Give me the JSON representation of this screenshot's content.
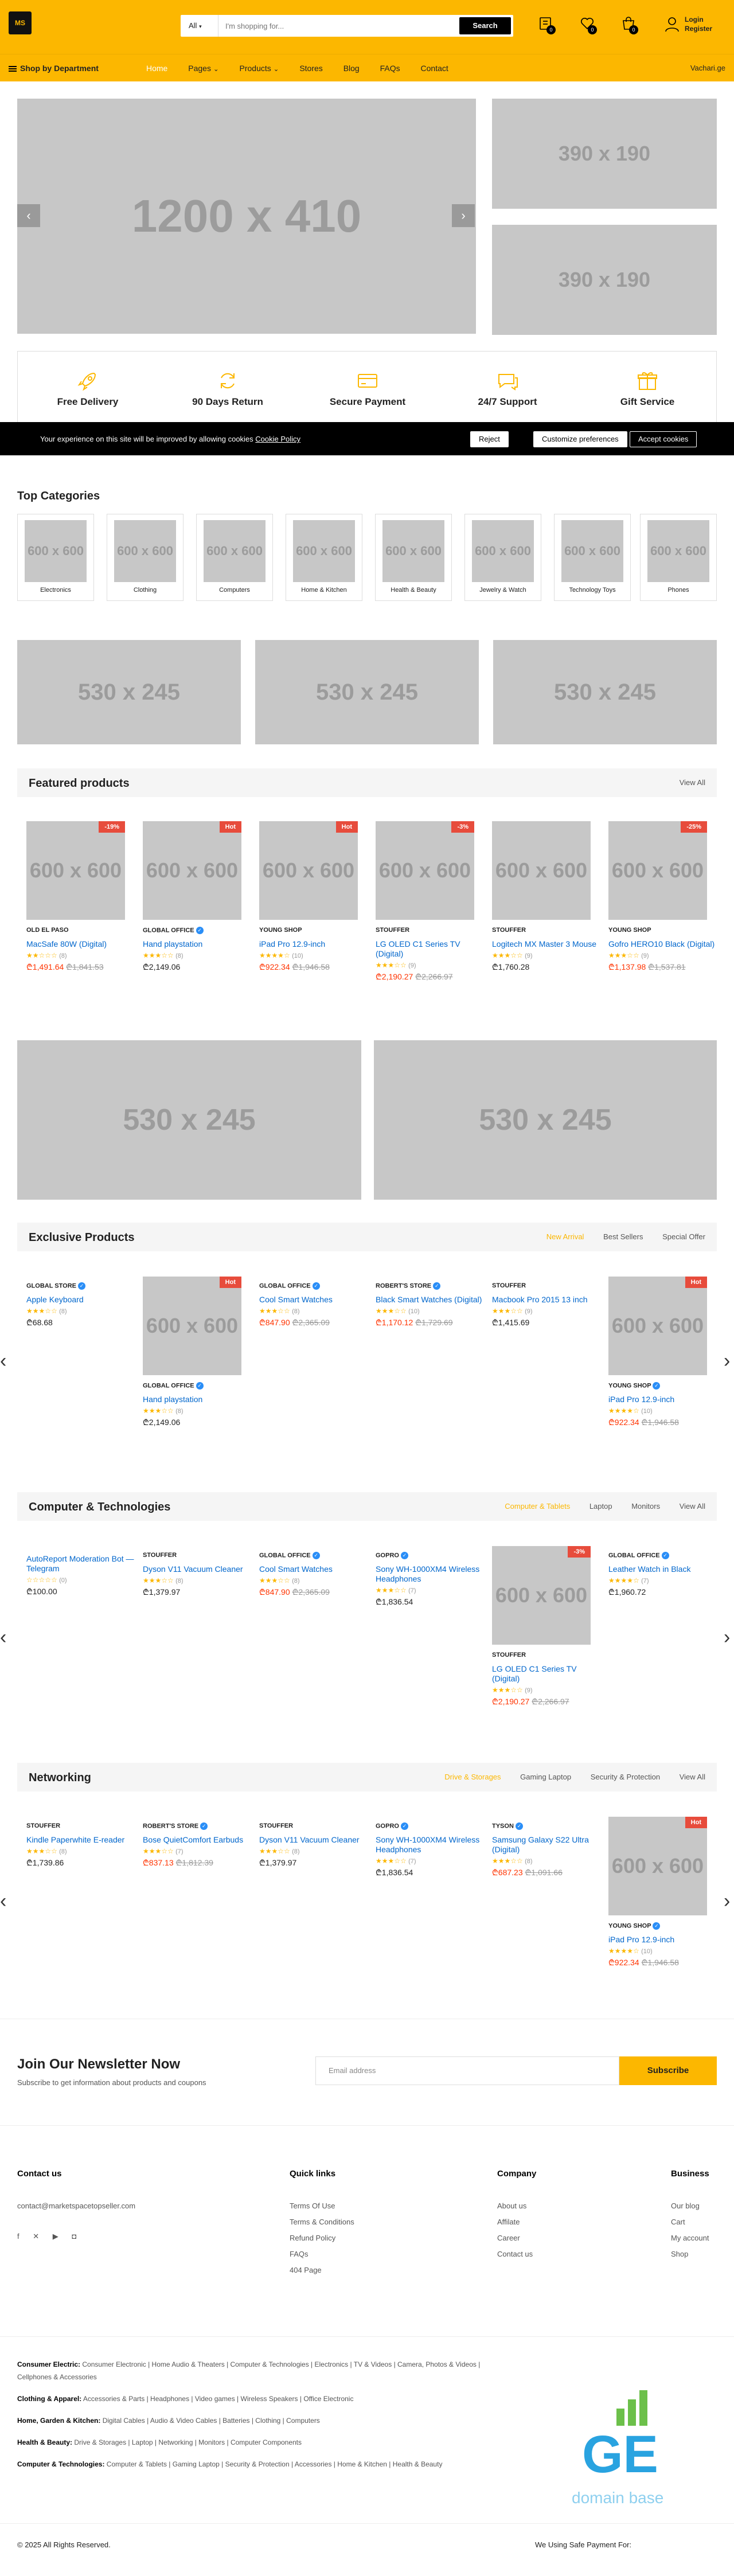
{
  "header": {
    "logo_text": "MS",
    "search_category": "All",
    "search_placeholder": "I'm shopping for...",
    "search_button": "Search",
    "compare_count": "0",
    "wishlist_count": "0",
    "cart_count": "0",
    "login": "Login",
    "register": "Register"
  },
  "nav": {
    "department": "Shop by Department",
    "items": [
      "Home",
      "Pages",
      "Products",
      "Stores",
      "Blog",
      "FAQs",
      "Contact"
    ],
    "right_link": "Vachari.ge"
  },
  "hero": {
    "main": "1200 x 410",
    "side1": "390 x 190",
    "side2": "390 x 190",
    "prev": "‹",
    "next": "›"
  },
  "features": [
    {
      "title": "Free Delivery",
      "icon": "rocket-icon"
    },
    {
      "title": "90 Days Return",
      "icon": "refresh-icon"
    },
    {
      "title": "Secure Payment",
      "icon": "credit-card-icon"
    },
    {
      "title": "24/7 Support",
      "icon": "chat-icon"
    },
    {
      "title": "Gift Service",
      "icon": "gift-icon"
    }
  ],
  "cookie": {
    "message": "Your experience on this site will be improved by allowing cookies",
    "policy": "Cookie Policy",
    "reject": "Reject",
    "customize": "Customize preferences",
    "accept": "Accept cookies"
  },
  "top_categories": {
    "title": "Top Categories",
    "items": [
      "Electronics",
      "Clothing",
      "Computers",
      "Home & Kitchen",
      "Health & Beauty",
      "Jewelry & Watch",
      "Technology Toys",
      "Phones"
    ],
    "ph": "600 x 600"
  },
  "promo_ph": "530 x 245",
  "featured": {
    "title": "Featured products",
    "view_all": "View All",
    "ph": "600 x 600",
    "products": [
      {
        "shop": "OLD EL PASO",
        "name": "MacSafe 80W (Digital)",
        "stars": "★★☆☆☆",
        "reviews": "(8)",
        "price": "₾1,491.64",
        "old": "₾1,841.53",
        "tag": "-19%"
      },
      {
        "shop": "GLOBAL OFFICE",
        "name": "Hand playstation",
        "stars": "★★★☆☆",
        "reviews": "(8)",
        "price": "₾2,149.06",
        "old": "",
        "tag": "Hot"
      },
      {
        "shop": "YOUNG SHOP",
        "name": "iPad Pro 12.9-inch",
        "stars": "★★★★☆",
        "reviews": "(10)",
        "price": "₾922.34",
        "old": "₾1,946.58",
        "tag": "Hot"
      },
      {
        "shop": "STOUFFER",
        "name": "LG OLED C1 Series TV (Digital)",
        "stars": "★★★☆☆",
        "reviews": "(9)",
        "price": "₾2,190.27",
        "old": "₾2,266.97",
        "tag": "-3%"
      },
      {
        "shop": "STOUFFER",
        "name": "Logitech MX Master 3 Mouse",
        "stars": "★★★☆☆",
        "reviews": "(9)",
        "price": "₾1,760.28",
        "old": "",
        "tag": ""
      },
      {
        "shop": "YOUNG SHOP",
        "name": "Gofro HERO10 Black (Digital)",
        "stars": "★★★☆☆",
        "reviews": "(9)",
        "price": "₾1,137.98",
        "old": "₾1,537.81",
        "tag": "-25%"
      }
    ]
  },
  "exclusive": {
    "title": "Exclusive Products",
    "tabs": [
      "New Arrival",
      "Best Sellers",
      "Special Offer"
    ],
    "col1": {
      "shop": "GLOBAL STORE",
      "name": "Apple Keyboard",
      "stars": "★★★☆☆",
      "reviews": "(8)",
      "price": "₾68.68"
    },
    "col2": {
      "shop": "GLOBAL OFFICE",
      "name": "Hand playstation",
      "stars": "★★★☆☆",
      "reviews": "(8)",
      "price": "₾2,149.06",
      "tag": "Hot"
    },
    "col3": {
      "shop": "GLOBAL OFFICE",
      "name": "Cool Smart Watches",
      "stars": "★★★☆☆",
      "reviews": "(8)",
      "price": "₾847.90",
      "old": "₾2,365.09"
    },
    "col4": {
      "shop": "ROBERT'S STORE",
      "name": "Black Smart Watches (Digital)",
      "stars": "★★★☆☆",
      "reviews": "(10)",
      "price": "₾1,170.12",
      "old": "₾1,729.69"
    },
    "col5": {
      "shop": "STOUFFER",
      "name": "Macbook Pro 2015 13 inch",
      "stars": "★★★☆☆",
      "reviews": "(9)",
      "price": "₾1,415.69"
    },
    "col6": {
      "shop": "YOUNG SHOP",
      "name": "iPad Pro 12.9-inch",
      "stars": "★★★★☆",
      "reviews": "(10)",
      "price": "₾922.34",
      "old": "₾1,946.58",
      "tag": "Hot"
    }
  },
  "computers": {
    "title": "Computer & Technologies",
    "tabs": [
      "Computer & Tablets",
      "Laptop",
      "Monitors",
      "View All"
    ],
    "col1": {
      "name": "AutoReport Moderation Bot — Telegram",
      "stars": "☆☆☆☆☆",
      "reviews": "(0)",
      "price": "₾100.00"
    },
    "col2": {
      "shop": "STOUFFER",
      "name": "Dyson V11 Vacuum Cleaner",
      "stars": "★★★☆☆",
      "reviews": "(8)",
      "price": "₾1,379.97"
    },
    "col3": {
      "shop": "GLOBAL OFFICE",
      "name": "Cool Smart Watches",
      "stars": "★★★☆☆",
      "reviews": "(8)",
      "price": "₾847.90",
      "old": "₾2,365.09"
    },
    "col4": {
      "shop": "GOPRO",
      "name": "Sony WH-1000XM4 Wireless Headphones",
      "stars": "★★★☆☆",
      "reviews": "(7)",
      "price": "₾1,836.54"
    },
    "col5": {
      "shop": "STOUFFER",
      "name": "LG OLED C1 Series TV (Digital)",
      "stars": "★★★☆☆",
      "reviews": "(9)",
      "price": "₾2,190.27",
      "old": "₾2,266.97",
      "tag": "-3%"
    },
    "col6": {
      "shop": "GLOBAL OFFICE",
      "name": "Leather Watch in Black",
      "stars": "★★★★☆",
      "reviews": "(7)",
      "price": "₾1,960.72"
    }
  },
  "networking": {
    "title": "Networking",
    "tabs": [
      "Drive & Storages",
      "Gaming Laptop",
      "Security & Protection",
      "View All"
    ],
    "col1": {
      "shop": "STOUFFER",
      "name": "Kindle Paperwhite E-reader",
      "stars": "★★★☆☆",
      "reviews": "(8)",
      "price": "₾1,739.86"
    },
    "col2": {
      "shop": "ROBERT'S STORE",
      "name": "Bose QuietComfort Earbuds",
      "stars": "★★★☆☆",
      "reviews": "(7)",
      "price": "₾837.13",
      "old": "₾1,812.39"
    },
    "col3": {
      "shop": "STOUFFER",
      "name": "Dyson V11 Vacuum Cleaner",
      "stars": "★★★☆☆",
      "reviews": "(8)",
      "price": "₾1,379.97"
    },
    "col4": {
      "shop": "GOPRO",
      "name": "Sony WH-1000XM4 Wireless Headphones",
      "stars": "★★★☆☆",
      "reviews": "(7)",
      "price": "₾1,836.54"
    },
    "col5": {
      "shop": "TYSON",
      "name": "Samsung Galaxy S22 Ultra (Digital)",
      "stars": "★★★☆☆",
      "reviews": "(8)",
      "price": "₾687.23",
      "old": "₾1,091.66"
    },
    "col6": {
      "shop": "YOUNG SHOP",
      "name": "iPad Pro 12.9-inch",
      "stars": "★★★★☆",
      "reviews": "(10)",
      "price": "₾922.34",
      "old": "₾1,946.58",
      "tag": "Hot"
    }
  },
  "newsletter": {
    "title": "Join Our Newsletter Now",
    "subtitle": "Subscribe to get information about products and coupons",
    "placeholder": "Email address",
    "button": "Subscribe"
  },
  "footer": {
    "contact_title": "Contact us",
    "email": "contact@marketspacetopseller.com",
    "quick_title": "Quick links",
    "quick": [
      "Terms Of Use",
      "Terms & Conditions",
      "Refund Policy",
      "FAQs",
      "404 Page"
    ],
    "company_title": "Company",
    "company": [
      "About us",
      "Affilate",
      "Career",
      "Contact us"
    ],
    "business_title": "Business",
    "business": [
      "Our blog",
      "Cart",
      "My account",
      "Shop"
    ],
    "rows": [
      {
        "label": "Consumer Electric:",
        "items": "Consumer Electronic | Home Audio & Theaters | Computer & Technologies | Electronics | TV & Videos | Camera, Photos & Videos |",
        "items2": "Cellphones & Accessories"
      },
      {
        "label": "Clothing & Apparel:",
        "items": "Accessories & Parts | Headphones | Video games | Wireless Speakers | Office Electronic",
        "items2": ""
      },
      {
        "label": "Home, Garden & Kitchen:",
        "items": "Digital Cables | Audio & Video Cables | Batteries | Clothing | Computers",
        "items2": ""
      },
      {
        "label": "Health & Beauty:",
        "items": "Drive & Storages | Laptop | Networking | Monitors | Computer Components",
        "items2": ""
      },
      {
        "label": "Computer & Technologies:",
        "items": "Computer & Tablets | Gaming Laptop | Security & Protection | Accessories | Home & Kitchen | Health & Beauty",
        "items2": ""
      }
    ],
    "copyright": "© 2025 All Rights Reserved.",
    "payment": "We Using Safe Payment For:",
    "watermark": "domain base",
    "watermark_logo": "GE"
  }
}
